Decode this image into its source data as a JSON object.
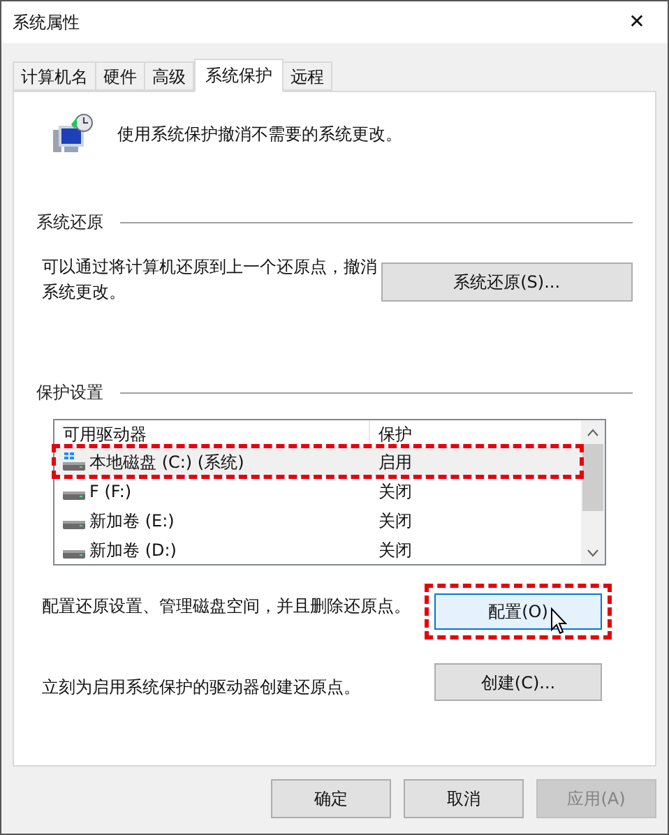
{
  "window": {
    "title": "系统属性",
    "close": "✕"
  },
  "tabs": [
    {
      "label": "计算机名",
      "selected": false
    },
    {
      "label": "硬件",
      "selected": false
    },
    {
      "label": "高级",
      "selected": false
    },
    {
      "label": "系统保护",
      "selected": true
    },
    {
      "label": "远程",
      "selected": false
    }
  ],
  "intro": "使用系统保护撤消不需要的系统更改。",
  "restore": {
    "heading": "系统还原",
    "description": "可以通过将计算机还原到上一个还原点，撤消系统更改。",
    "button": "系统还原(S)..."
  },
  "protection": {
    "heading": "保护设置",
    "columns": [
      "可用驱动器",
      "保护"
    ],
    "drives": [
      {
        "name": "本地磁盘 (C:) (系统)",
        "status": "启用",
        "kind": "system",
        "selected": true,
        "highlighted": true
      },
      {
        "name": "F (F:)",
        "status": "关闭",
        "kind": "drive",
        "selected": false,
        "highlighted": false
      },
      {
        "name": "新加卷 (E:)",
        "status": "关闭",
        "kind": "drive",
        "selected": false,
        "highlighted": false
      },
      {
        "name": "新加卷 (D:)",
        "status": "关闭",
        "kind": "drive",
        "selected": false,
        "highlighted": false
      }
    ],
    "configure": {
      "description": "配置还原设置、管理磁盘空间，并且删除还原点。",
      "button": "配置(O)",
      "hovered": true,
      "highlighted": true
    },
    "create": {
      "description": "立刻为启用系统保护的驱动器创建还原点。",
      "button": "创建(C)..."
    }
  },
  "buttons": [
    {
      "label": "确定",
      "disabled": false
    },
    {
      "label": "取消",
      "disabled": false
    },
    {
      "label": "应用(A)",
      "disabled": true
    }
  ]
}
